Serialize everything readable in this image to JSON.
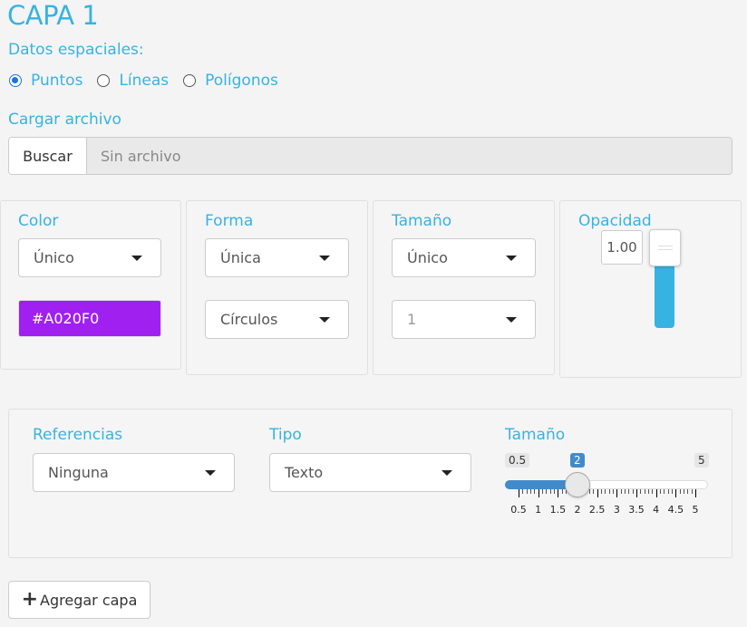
{
  "layer_title": "CAPA 1",
  "spatial": {
    "label": "Datos espaciales:",
    "options": [
      "Puntos",
      "Líneas",
      "Polígonos"
    ],
    "selected": "Puntos"
  },
  "upload": {
    "label": "Cargar archivo",
    "button": "Buscar",
    "placeholder": "Sin archivo"
  },
  "color_panel": {
    "label": "Color",
    "mode": "Único",
    "value": "#A020F0"
  },
  "shape_panel": {
    "label": "Forma",
    "mode": "Única",
    "shape": "Círculos"
  },
  "size_panel": {
    "label": "Tamaño",
    "mode": "Único",
    "value": "1"
  },
  "opacity_panel": {
    "label": "Opacidad",
    "value": "1.00",
    "level": 1.0,
    "track_color": "#37b3e1"
  },
  "references": {
    "label": "Referencias",
    "value": "Ninguna"
  },
  "type": {
    "label": "Tipo",
    "value": "Texto"
  },
  "size_slider": {
    "label": "Tamaño",
    "min": "0.5",
    "max": "5",
    "value": "2",
    "value_num": 2,
    "min_num": 0.5,
    "max_num": 5,
    "tick_labels": [
      "0.5",
      "1",
      "1.5",
      "2",
      "2.5",
      "3",
      "3.5",
      "4",
      "4.5",
      "5"
    ]
  },
  "add_button": {
    "label": "Agregar capa"
  },
  "colors": {
    "accent": "#37b3e1",
    "swatch": "#A020F0",
    "slider": "#428bca"
  },
  "icons": {
    "dropdown": "caret-down-icon",
    "add": "plus-icon"
  }
}
